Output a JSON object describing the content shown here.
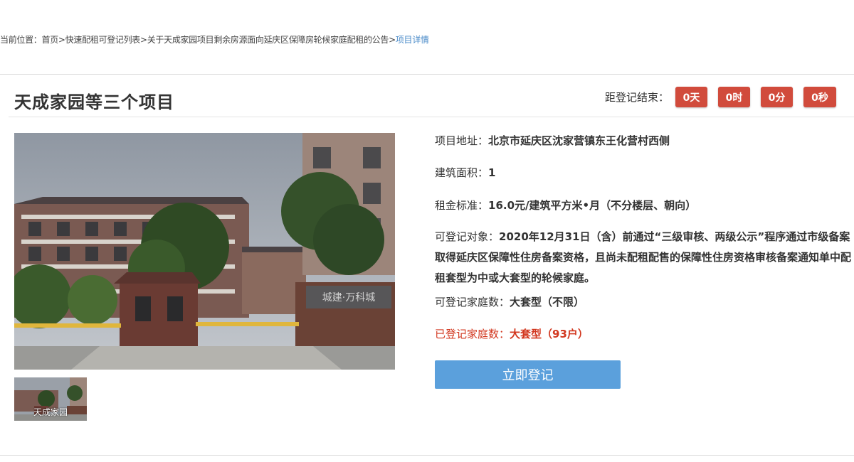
{
  "breadcrumb": {
    "prefix": "当前位置：",
    "items": [
      "首页",
      "快速配租可登记列表",
      "关于天成家园项目剩余房源面向延庆区保障房轮候家庭配租的公告"
    ],
    "separator": ">",
    "current": "项目详情"
  },
  "project": {
    "title": "天成家园等三个项目",
    "thumbnail_caption": "天成家园"
  },
  "countdown": {
    "label": "距登记结束：",
    "days": "0天",
    "hours": "0时",
    "minutes": "0分",
    "seconds": "0秒"
  },
  "details": {
    "address_label": "项目地址：",
    "address_value": "北京市延庆区沈家营镇东王化营村西侧",
    "area_label": "建筑面积：",
    "area_value": "1",
    "rent_label": "租金标准：",
    "rent_value": "16.0元/建筑平方米•月（不分楼层、朝向）",
    "target_label": "可登记对象：",
    "target_value": "2020年12月31日（含）前通过“三级审核、两级公示”程序通过市级备案取得延庆区保障性住房备案资格，且尚未配租配售的保障性住房资格审核备案通知单中配租套型为中或大套型的轮候家庭。",
    "quota_label": "可登记家庭数：",
    "quota_value": "大套型（不限）",
    "registered_label": "已登记家庭数：",
    "registered_value": "大套型（93户）"
  },
  "actions": {
    "register_label": "立即登记"
  },
  "colors": {
    "countdown_bg": "#d14b3c",
    "register_bg": "#5ba0dc",
    "registered_text": "#d2371f",
    "breadcrumb_current": "#4a8bc9"
  }
}
